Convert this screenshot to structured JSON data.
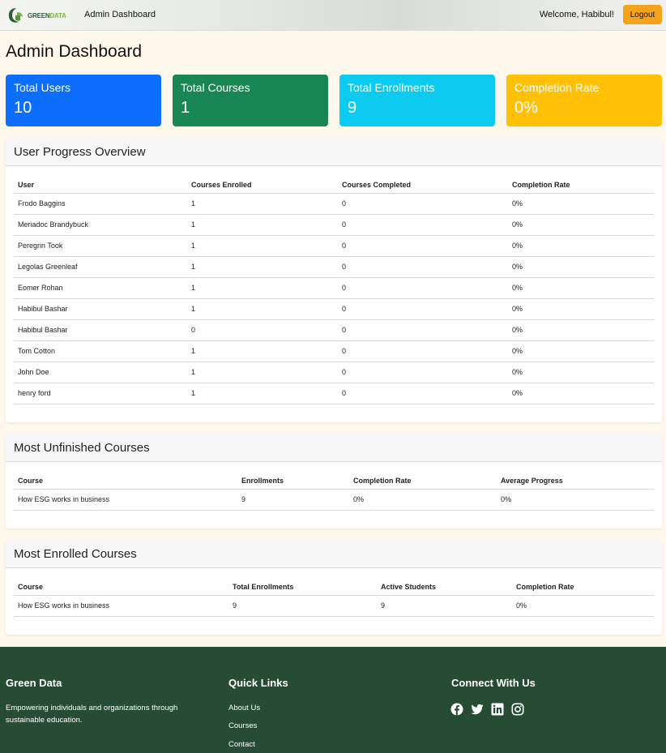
{
  "nav": {
    "brand_part1": "GREEN",
    "brand_part2": "DATA",
    "link": "Admin Dashboard",
    "welcome": "Welcome, Habibul!",
    "logout": "Logout"
  },
  "page_title": "Admin Dashboard",
  "stats": [
    {
      "label": "Total Users",
      "value": "10",
      "color": "#0d6efd"
    },
    {
      "label": "Total Courses",
      "value": "1",
      "color": "#198754"
    },
    {
      "label": "Total Enrollments",
      "value": "9",
      "color": "#0dcaf0"
    },
    {
      "label": "Completion Rate",
      "value": "0%",
      "color": "#ffc107"
    }
  ],
  "user_progress": {
    "title": "User Progress Overview",
    "columns": [
      "User",
      "Courses Enrolled",
      "Courses Completed",
      "Completion Rate"
    ],
    "rows": [
      [
        "Frodo Baggins",
        "1",
        "0",
        "0%"
      ],
      [
        "Meriadoc Brandybuck",
        "1",
        "0",
        "0%"
      ],
      [
        "Peregrin Took",
        "1",
        "0",
        "0%"
      ],
      [
        "Legolas Greenleaf",
        "1",
        "0",
        "0%"
      ],
      [
        "Eomer Rohan",
        "1",
        "0",
        "0%"
      ],
      [
        "Habibul Bashar",
        "1",
        "0",
        "0%"
      ],
      [
        "Habibul Bashar",
        "0",
        "0",
        "0%"
      ],
      [
        "Tom Cotton",
        "1",
        "0",
        "0%"
      ],
      [
        "John Doe",
        "1",
        "0",
        "0%"
      ],
      [
        "henry ford",
        "1",
        "0",
        "0%"
      ]
    ]
  },
  "unfinished": {
    "title": "Most Unfinished Courses",
    "columns": [
      "Course",
      "Enrollments",
      "Completion Rate",
      "Average Progress"
    ],
    "rows": [
      [
        "How ESG works in business",
        "9",
        "0%",
        "0%"
      ]
    ]
  },
  "enrolled": {
    "title": "Most Enrolled Courses",
    "columns": [
      "Course",
      "Total Enrollments",
      "Active Students",
      "Completion Rate"
    ],
    "rows": [
      [
        "How ESG works in business",
        "9",
        "9",
        "0%"
      ]
    ]
  },
  "footer": {
    "about_title": "Green Data",
    "about_text": "Empowering individuals and organizations through sustainable education.",
    "links_title": "Quick Links",
    "links": [
      "About Us",
      "Courses",
      "Contact"
    ],
    "social_title": "Connect With Us",
    "social_icons": [
      "facebook-icon",
      "twitter-icon",
      "linkedin-icon",
      "instagram-icon"
    ]
  }
}
